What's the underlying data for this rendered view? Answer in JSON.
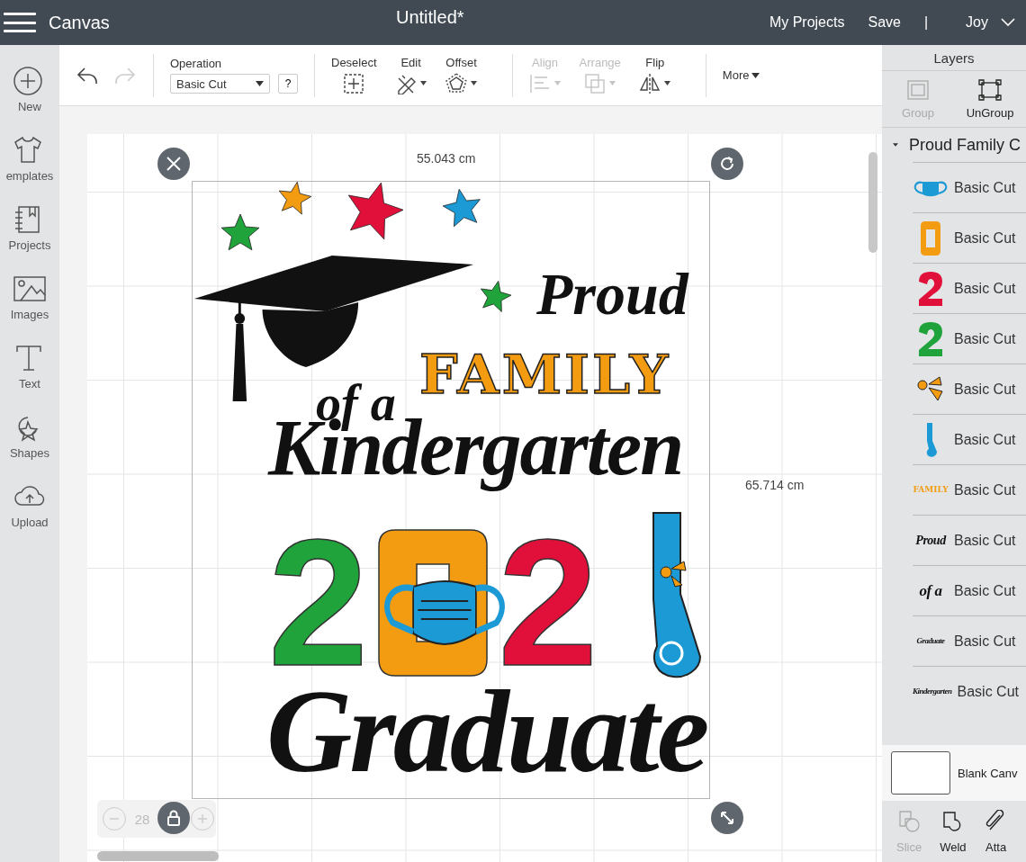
{
  "top_bar": {
    "app_name": "Canvas",
    "title": "Untitled*",
    "links": [
      "My Projects",
      "Save"
    ],
    "separator": "|",
    "user": "Joy"
  },
  "sidebar": {
    "items": [
      {
        "label": "New",
        "kind": "new"
      },
      {
        "label": "emplates",
        "kind": "templates"
      },
      {
        "label": "Projects",
        "kind": "projects"
      },
      {
        "label": "Images",
        "kind": "images"
      },
      {
        "label": "Text",
        "kind": "text"
      },
      {
        "label": "Shapes",
        "kind": "shapes"
      },
      {
        "label": "Upload",
        "kind": "upload"
      }
    ]
  },
  "toolbar": {
    "operation": {
      "label": "Operation",
      "value": "Basic Cut",
      "help": "?"
    },
    "tools": [
      {
        "label": "Deselect",
        "kind": "deselect",
        "disabled": false
      },
      {
        "label": "Edit",
        "kind": "edit",
        "disabled": false
      },
      {
        "label": "Offset",
        "kind": "offset",
        "disabled": false
      },
      {
        "label": "Align",
        "kind": "align",
        "disabled": true
      },
      {
        "label": "Arrange",
        "kind": "arrange",
        "disabled": true
      },
      {
        "label": "Flip",
        "kind": "flip",
        "disabled": false
      }
    ],
    "more": "More"
  },
  "canvas": {
    "width_label": "55.043 cm",
    "height_label": "65.714 cm",
    "zoom": "28",
    "design": {
      "proud": "Proud",
      "family": "FAMILY",
      "of_a": "of a",
      "kindergarten": "Kindergarten",
      "year_digits": [
        {
          "text": "2",
          "color": "#1fa33a"
        },
        {
          "text": "2",
          "color": "#e0103a"
        }
      ],
      "graduate": "Graduate"
    }
  },
  "layers": {
    "title": "Layers",
    "group": {
      "label": "Group",
      "disabled": true
    },
    "ungroup": {
      "label": "UnGroup",
      "disabled": false
    },
    "group_row": {
      "name": "Proud Family C",
      "expanded": true
    },
    "items": [
      {
        "kind": "mask",
        "label": "Basic Cut"
      },
      {
        "kind": "zero",
        "label": "Basic Cut"
      },
      {
        "kind": "two",
        "color": "#e0103a",
        "label": "Basic Cut"
      },
      {
        "kind": "two",
        "color": "#1fa33a",
        "label": "Basic Cut"
      },
      {
        "kind": "bow",
        "label": "Basic Cut"
      },
      {
        "kind": "scroll",
        "label": "Basic Cut"
      },
      {
        "kind": "block-text",
        "thumb_text": "FAMILY",
        "label": "Basic Cut"
      },
      {
        "kind": "script-text",
        "thumb_text": "Proud",
        "label": "Basic Cut"
      },
      {
        "kind": "script-text",
        "thumb_text": "of a",
        "label": "Basic Cut"
      },
      {
        "kind": "script-text",
        "thumb_text": "Graduate",
        "label": "Basic Cut"
      },
      {
        "kind": "script-text",
        "thumb_text": "Kindergarten",
        "label": "Basic Cut"
      }
    ],
    "blank_canvas": "Blank Canv",
    "actions": [
      {
        "label": "Slice",
        "kind": "slice",
        "disabled": true
      },
      {
        "label": "Weld",
        "kind": "weld",
        "disabled": false
      },
      {
        "label": "Atta",
        "kind": "attach",
        "disabled": false
      }
    ]
  }
}
